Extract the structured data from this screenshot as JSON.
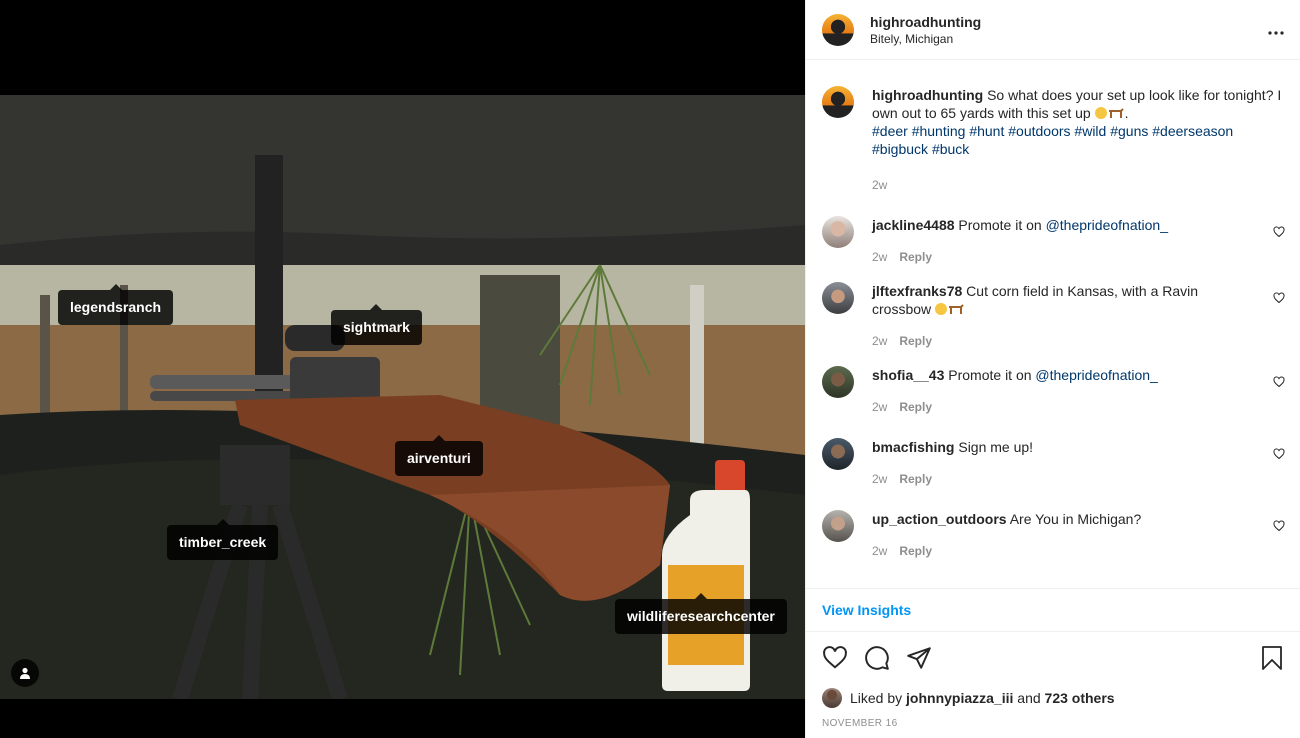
{
  "post": {
    "username": "highroadhunting",
    "location": "Bitely, Michigan",
    "caption": {
      "username": "highroadhunting",
      "text": "So what does your set up look like for tonight? I own out to 65 yards with this set up",
      "hashtags": [
        "#deer",
        "#hunting",
        "#hunt",
        "#outdoors",
        "#wild",
        "#guns",
        "#deerseason",
        "#bigbuck",
        "#buck"
      ],
      "time": "2w"
    },
    "tags": [
      "legendsranch",
      "sightmark",
      "airventuri",
      "timber_creek",
      "wildliferesearchcenter"
    ]
  },
  "comments": [
    {
      "user": "jackline4488",
      "text": "Promote it on ",
      "mention": "@theprideofnation_",
      "time": "2w",
      "reply": "Reply"
    },
    {
      "user": "jlftexfranks78",
      "text": "Cut corn field in Kansas, with a Ravin crossbow",
      "mention": "",
      "time": "2w",
      "reply": "Reply"
    },
    {
      "user": "shofia__43",
      "text": "Promote it on ",
      "mention": "@theprideofnation_",
      "time": "2w",
      "reply": "Reply"
    },
    {
      "user": "bmacfishing",
      "text": "Sign me up!",
      "mention": "",
      "time": "2w",
      "reply": "Reply"
    },
    {
      "user": "up_action_outdoors",
      "text": "Are You in Michigan?",
      "mention": "",
      "time": "2w",
      "reply": "Reply"
    }
  ],
  "insights_label": "View Insights",
  "likes": {
    "prefix": "Liked by ",
    "user": "johnnypiazza_iii",
    "joiner": " and ",
    "others": "723 others"
  },
  "date": "NOVEMBER 16",
  "icons": {
    "more": "more-horizontal-icon",
    "heart": "heart-icon",
    "comment": "comment-icon",
    "share": "share-icon",
    "save": "bookmark-icon",
    "user": "user-tag-icon"
  }
}
